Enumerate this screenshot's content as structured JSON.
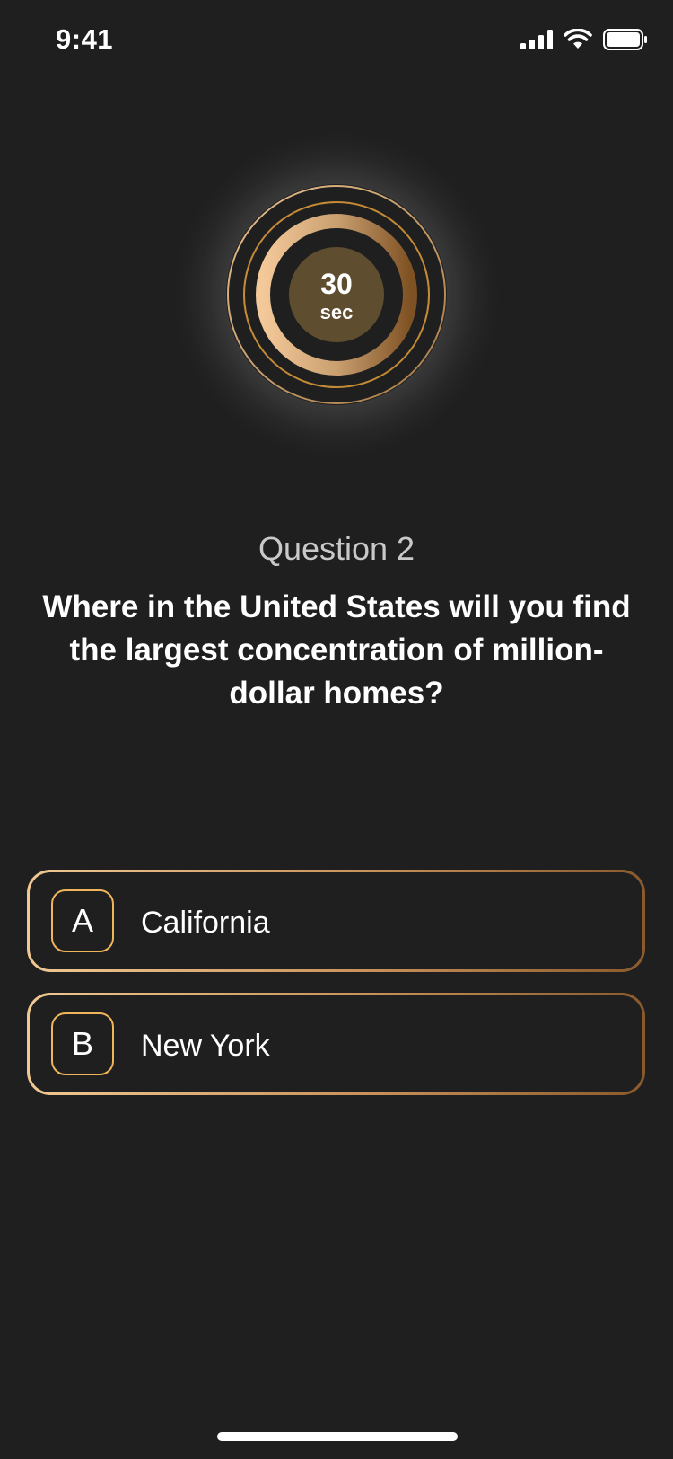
{
  "status_bar": {
    "time": "9:41",
    "icons": [
      "signal-icon",
      "wifi-icon",
      "battery-icon"
    ]
  },
  "timer": {
    "value": "30",
    "unit": "sec"
  },
  "question": {
    "number_label": "Question 2",
    "text": "Where in the United States will you find the largest concentration of million-dollar homes?"
  },
  "answers": [
    {
      "letter": "A",
      "label": "California"
    },
    {
      "letter": "B",
      "label": "New York"
    }
  ],
  "colors": {
    "background": "#1f1f1f",
    "accent_light": "#f0c893",
    "accent_dark": "#8a5a2c",
    "letter_border": "#f0b55a",
    "timer_center": "#5e4d2e"
  }
}
